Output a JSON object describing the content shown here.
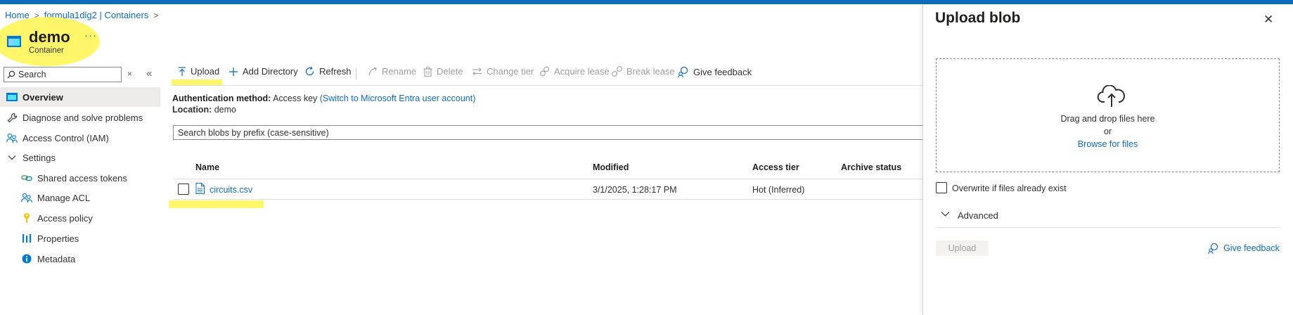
{
  "breadcrumb": {
    "home": "Home",
    "account": "formula1dlg2 | Containers"
  },
  "resource": {
    "title": "demo",
    "subtitle": "Container",
    "more": "···"
  },
  "sidebar": {
    "search_placeholder": "Search",
    "items": [
      {
        "label": "Overview",
        "icon": "container-icon"
      },
      {
        "label": "Diagnose and solve problems",
        "icon": "wrench-icon"
      },
      {
        "label": "Access Control (IAM)",
        "icon": "people-icon"
      },
      {
        "label": "Settings",
        "icon": "chevron-down-icon"
      },
      {
        "label": "Shared access tokens",
        "icon": "link-icon"
      },
      {
        "label": "Manage ACL",
        "icon": "people-icon"
      },
      {
        "label": "Access policy",
        "icon": "key-icon"
      },
      {
        "label": "Properties",
        "icon": "bars-icon"
      },
      {
        "label": "Metadata",
        "icon": "info-icon"
      }
    ]
  },
  "toolbar": {
    "upload": "Upload",
    "add_directory": "Add Directory",
    "refresh": "Refresh",
    "rename": "Rename",
    "delete": "Delete",
    "change_tier": "Change tier",
    "acquire_lease": "Acquire lease",
    "break_lease": "Break lease",
    "give_feedback": "Give feedback"
  },
  "info": {
    "auth_label": "Authentication method:",
    "auth_value": "Access key",
    "auth_link": "(Switch to Microsoft Entra user account)",
    "location_label": "Location:",
    "location_value": "demo"
  },
  "blob_search": {
    "placeholder": "Search blobs by prefix (case-sensitive)"
  },
  "table": {
    "columns": [
      "Name",
      "Modified",
      "Access tier",
      "Archive status"
    ],
    "rows": [
      {
        "name": "circuits.csv",
        "modified": "3/1/2025, 1:28:17 PM",
        "access_tier": "Hot (Inferred)",
        "archive_status": ""
      }
    ]
  },
  "upload_panel": {
    "title": "Upload blob",
    "drag_text": "Drag and drop files here",
    "or_text": "or",
    "browse_link": "Browse for files",
    "overwrite_label": "Overwrite if files already exist",
    "advanced_label": "Advanced",
    "upload_button": "Upload",
    "feedback_link": "Give feedback"
  },
  "colors": {
    "accent": "#0f6cbd",
    "highlight": "#fff550",
    "disabled": "#a19f9d"
  }
}
